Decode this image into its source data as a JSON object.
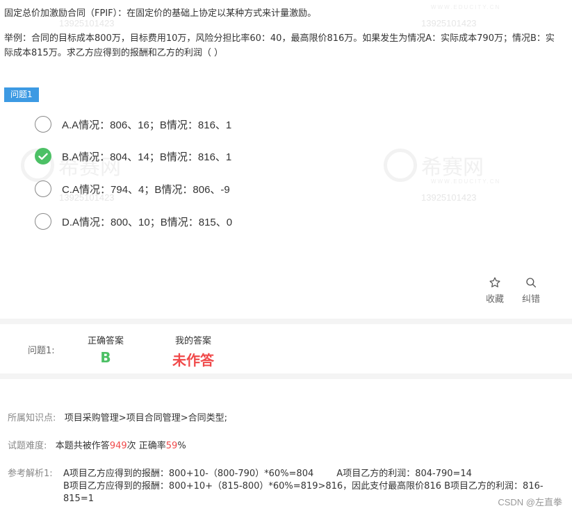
{
  "question": {
    "title": "固定总价加激励合同（FPIF）：在固定价的基础上协定以某种方式来计量激励。",
    "example": "举例：合同的目标成本800万，目标费用10万，风险分担比率60：40，最高限价816万。如果发生为情况A：实际成本790万；情况B：实际成本815万。求乙方应得到的报酬和乙方的利润（    ）"
  },
  "question_tag": "问题1",
  "options": [
    {
      "label": "A.A情况：806、16；B情况：816、1",
      "selected": false
    },
    {
      "label": "B.A情况：804、14；B情况：816、1",
      "selected": true
    },
    {
      "label": "C.A情况：794、4；B情况：806、-9",
      "selected": false
    },
    {
      "label": "D.A情况：800、10；B情况：815、0",
      "selected": false
    }
  ],
  "tools": {
    "favorite": "收藏",
    "report": "纠错"
  },
  "answer": {
    "row_label": "问题1:",
    "correct_caption": "正确答案",
    "correct_value": "B",
    "mine_caption": "我的答案",
    "mine_value": "未作答"
  },
  "knowledge": {
    "label": "所属知识点:",
    "value": "项目采购管理>项目合同管理>合同类型;"
  },
  "difficulty": {
    "label": "试题难度:",
    "prefix": "本题共被作答",
    "count": "949",
    "mid": "次 正确率",
    "rate": "59",
    "suffix": "%"
  },
  "analysis": {
    "label": "参考解析1:",
    "line1": "A项目乙方应得到的报酬：800+10-（800-790）*60%=804        A项目乙方的利润：804-790=14",
    "line2": "B项目乙方应得到的报酬：800+10+（815-800）*60%=819>816，因此支付最高限价816    B项目乙方的利润：816-815=1"
  },
  "watermark": {
    "phone": "13925101423",
    "brand": "希赛网",
    "url": "WWW.EDUCITY.CN"
  },
  "footer": "CSDN @左直拳",
  "colors": {
    "accent": "#3d9ae3",
    "correct": "#4cc065",
    "wrong": "#f0494a"
  }
}
